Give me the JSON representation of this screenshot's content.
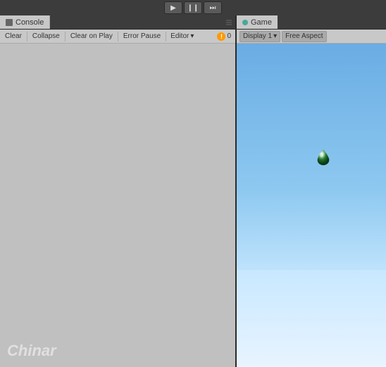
{
  "toolbar": {
    "play_label": "▶",
    "pause_label": "❙❙",
    "step_label": "⏭"
  },
  "console": {
    "tab_label": "Console",
    "tab_icon": "console-icon",
    "clear_btn": "Clear",
    "collapse_btn": "Collapse",
    "clear_on_play_btn": "Clear on Play",
    "error_pause_btn": "Error Pause",
    "editor_btn": "Editor",
    "error_count": "0",
    "watermark": "Chinar"
  },
  "game": {
    "tab_label": "Game",
    "tab_icon": "game-icon",
    "display_label": "Display 1",
    "aspect_label": "Free Aspect"
  }
}
